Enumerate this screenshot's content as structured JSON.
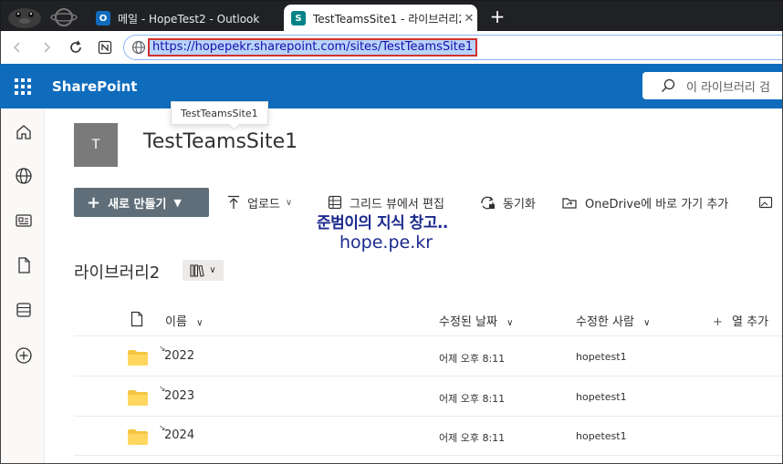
{
  "browser": {
    "tabs": [
      {
        "title": "메일 - HopeTest2 - Outlook",
        "icon": "outlook-icon",
        "active": false
      },
      {
        "title": "TestTeamsSite1 - 라이브러리2 -",
        "icon": "sharepoint-icon",
        "active": true
      }
    ],
    "url": "https://hopepekr.sharepoint.com/sites/TestTeamsSite1"
  },
  "suite": {
    "app_name": "SharePoint",
    "search_placeholder": "이 라이브러리 검"
  },
  "site": {
    "logo_letter": "T",
    "title": "TestTeamsSite1",
    "tooltip": "TestTeamsSite1"
  },
  "commands": {
    "new_label": "새로 만들기",
    "upload": "업로드",
    "grid_edit": "그리드 뷰에서 편집",
    "sync": "동기화",
    "onedrive_shortcut": "OneDrive에 바로 가기 추가"
  },
  "watermark": {
    "line1": "준범이의 지식 창고..",
    "line2": "hope.pe.kr"
  },
  "library": {
    "title": "라이브러리2",
    "columns": {
      "name": "이름",
      "modified": "수정된 날짜",
      "modified_by": "수정한 사람",
      "add_column": "열 추가"
    },
    "rows": [
      {
        "name": "2022",
        "modified": "어제 오후 8:11",
        "modified_by": "hopetest1"
      },
      {
        "name": "2023",
        "modified": "어제 오후 8:11",
        "modified_by": "hopetest1"
      },
      {
        "name": "2024",
        "modified": "어제 오후 8:11",
        "modified_by": "hopetest1"
      }
    ]
  },
  "colors": {
    "suite_bar": "#0f6cbd",
    "new_button": "#5f6e78",
    "folder": "#f4c542",
    "url_highlight_border": "#d32f2f"
  }
}
